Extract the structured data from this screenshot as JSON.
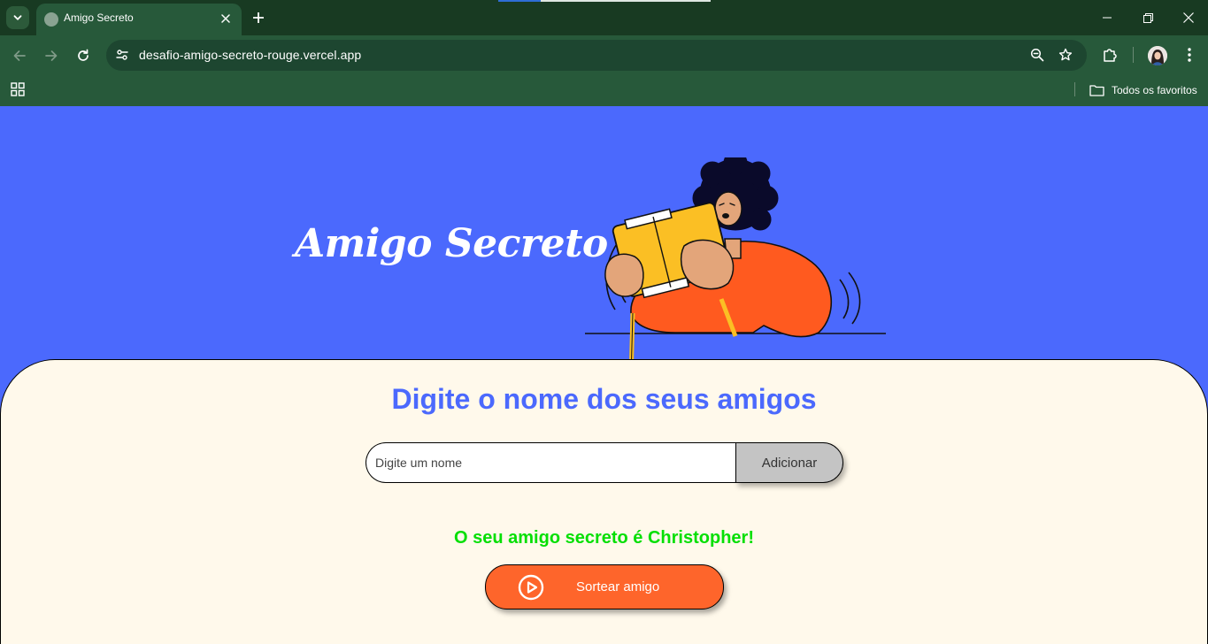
{
  "browser": {
    "tab": {
      "title": "Amigo Secreto",
      "favicon": "globe-icon"
    },
    "url": "desafio-amigo-secreto-rouge.vercel.app",
    "bookmarks": {
      "all_bookmarks_label": "Todos os favoritos"
    },
    "icons": {
      "tab_list": "chevron-down-icon",
      "tab_close": "close-icon",
      "new_tab": "plus-icon",
      "back": "arrow-left-icon",
      "forward": "arrow-right-icon",
      "reload": "reload-icon",
      "site_info": "tune-icon",
      "zoom": "zoom-icon",
      "bookmark_star": "star-icon",
      "extensions": "puzzle-icon",
      "menu": "more-vert-icon",
      "apps": "apps-grid-icon"
    },
    "colors": {
      "tabbar": "#183a22",
      "toolbar": "#27593a",
      "omnibox": "#1d4630"
    }
  },
  "page": {
    "title": "Amigo Secreto",
    "section_title": "Digite o nome dos seus amigos",
    "input": {
      "placeholder": "Digite um nome",
      "value": ""
    },
    "add_button": "Adicionar",
    "result": "O seu amigo secreto é Christopher!",
    "draw_button": "Sortear amigo",
    "colors": {
      "banner": "#4b69fd",
      "panel": "#fff9eb",
      "accent": "#4b69fd",
      "result": "#05df05",
      "draw_button": "#fe652b",
      "add_button": "#c4c4c4"
    }
  }
}
